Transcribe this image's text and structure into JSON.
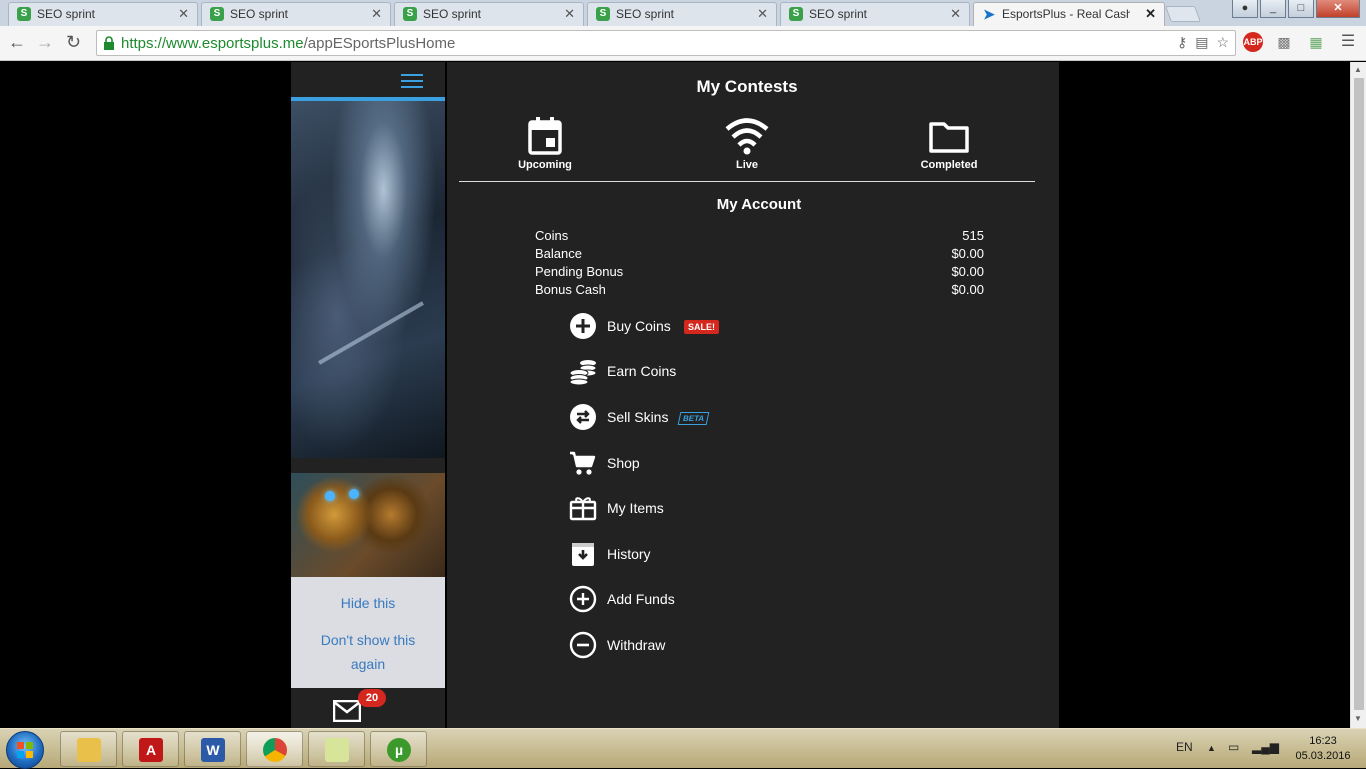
{
  "browser": {
    "tabs": [
      {
        "title": "SEO sprint"
      },
      {
        "title": "SEO sprint"
      },
      {
        "title": "SEO sprint"
      },
      {
        "title": "SEO sprint"
      },
      {
        "title": "SEO sprint"
      },
      {
        "title": "EsportsPlus - Real Cash Da"
      }
    ],
    "url_scheme": "https://",
    "url_host": "www.esportsplus.me",
    "url_path": "/appESportsPlusHome",
    "abp_label": "ABP"
  },
  "sidebar": {
    "promo_hide": "Hide this",
    "promo_dont_show": "Don't show this again",
    "mail_count": "20"
  },
  "contests": {
    "title": "My Contests",
    "tabs": [
      {
        "label": "Upcoming",
        "icon": "calendar-icon"
      },
      {
        "label": "Live",
        "icon": "wifi-icon"
      },
      {
        "label": "Completed",
        "icon": "folder-icon"
      }
    ]
  },
  "account": {
    "title": "My Account",
    "rows": [
      {
        "label": "Coins",
        "value": "515"
      },
      {
        "label": "Balance",
        "value": "$0.00"
      },
      {
        "label": "Pending Bonus",
        "value": "$0.00"
      },
      {
        "label": "Bonus Cash",
        "value": "$0.00"
      }
    ],
    "menu": [
      {
        "label": "Buy Coins",
        "icon": "plus-circle-icon",
        "badge": "SALE!"
      },
      {
        "label": "Earn Coins",
        "icon": "coins-icon"
      },
      {
        "label": "Sell Skins",
        "icon": "exchange-icon",
        "badge": "BETA"
      },
      {
        "label": "Shop",
        "icon": "cart-icon"
      },
      {
        "label": "My Items",
        "icon": "gift-box-icon"
      },
      {
        "label": "History",
        "icon": "archive-icon"
      },
      {
        "label": "Add Funds",
        "icon": "plus-outline-icon"
      },
      {
        "label": "Withdraw",
        "icon": "minus-outline-icon"
      }
    ]
  },
  "taskbar": {
    "language": "EN",
    "time": "16:23",
    "date": "05.03.2016"
  },
  "colors": {
    "accent": "#3aa0e0",
    "panel": "#222222",
    "badge_red": "#d4271e"
  }
}
